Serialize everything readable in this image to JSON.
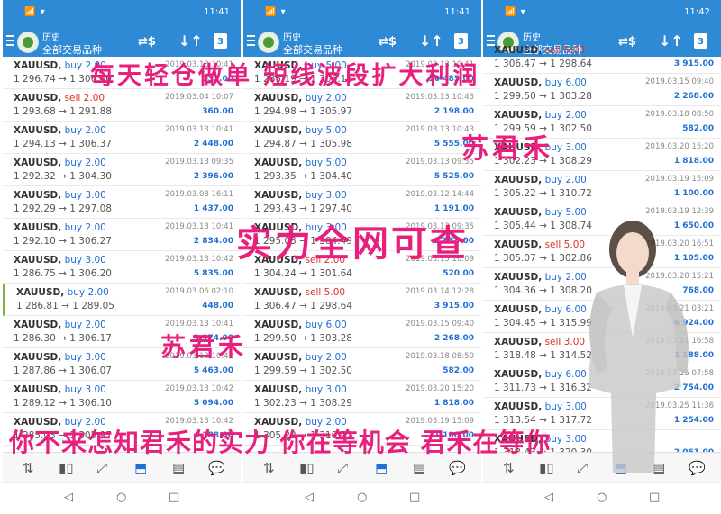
{
  "status_bar": {
    "signal": "📶 ▾",
    "time": [
      "11:41",
      "11:41",
      "11:42"
    ]
  },
  "toolbar": {
    "subtitle": "历史",
    "title": "全部交易品种",
    "calendar_day": "3"
  },
  "panels": [
    {
      "rows": [
        {
          "symbol": "XAUUSD,",
          "side": "buy",
          "vol": "2.00",
          "prices": "1 296.74 → 1 306.40",
          "date": "2019.03.13 10:41",
          "profit": "132.00"
        },
        {
          "symbol": "XAUUSD,",
          "side": "sell",
          "vol": "2.00",
          "prices": "1 293.68 → 1 291.88",
          "date": "2019.03.04 10:07",
          "profit": "360.00"
        },
        {
          "symbol": "XAUUSD,",
          "side": "buy",
          "vol": "2.00",
          "prices": "1 294.13 → 1 306.37",
          "date": "2019.03.13 10:41",
          "profit": "2 448.00"
        },
        {
          "symbol": "XAUUSD,",
          "side": "buy",
          "vol": "2.00",
          "prices": "1 292.32 → 1 304.30",
          "date": "2019.03.13 09:35",
          "profit": "2 396.00"
        },
        {
          "symbol": "XAUUSD,",
          "side": "buy",
          "vol": "3.00",
          "prices": "1 292.29 → 1 297.08",
          "date": "2019.03.08 16:11",
          "profit": "1 437.00"
        },
        {
          "symbol": "XAUUSD,",
          "side": "buy",
          "vol": "2.00",
          "prices": "1 292.10 → 1 306.27",
          "date": "2019.03.13 10:41",
          "profit": "2 834.00"
        },
        {
          "symbol": "XAUUSD,",
          "side": "buy",
          "vol": "3.00",
          "prices": "1 286.75 → 1 306.20",
          "date": "2019.03.13 10:42",
          "profit": "5 835.00"
        },
        {
          "symbol": "XAUUSD,",
          "side": "buy",
          "vol": "2.00",
          "prices": "1 286.81 → 1 289.05",
          "date": "2019.03.06 02:10",
          "profit": "448.00",
          "selected": true
        },
        {
          "symbol": "XAUUSD,",
          "side": "buy",
          "vol": "2.00",
          "prices": "1 286.30 → 1 306.17",
          "date": "2019.03.13 10:41",
          "profit": "3 974.00"
        },
        {
          "symbol": "XAUUSD,",
          "side": "buy",
          "vol": "3.00",
          "prices": "1 287.86 → 1 306.07",
          "date": "2019.03.13 10:42",
          "profit": "5 463.00"
        },
        {
          "symbol": "XAUUSD,",
          "side": "buy",
          "vol": "3.00",
          "prices": "1 289.12 → 1 306.10",
          "date": "2019.03.13 10:42",
          "profit": "5 094.00"
        },
        {
          "symbol": "XAUUSD,",
          "side": "buy",
          "vol": "2.00",
          "prices": "1 285.03 → 1 305.97",
          "date": "2019.03.13 10:42",
          "profit": "4 188.00"
        }
      ]
    },
    {
      "rows": [
        {
          "symbol": "XAUUSD,",
          "side": "buy",
          "vol": "5.00",
          "prices": "1 285.19 → 1 306.16",
          "date": "2019.03.13 10:41",
          "profit": "10 485.00"
        },
        {
          "symbol": "XAUUSD,",
          "side": "buy",
          "vol": "2.00",
          "prices": "1 294.98 → 1 305.97",
          "date": "2019.03.13 10:43",
          "profit": "2 198.00"
        },
        {
          "symbol": "XAUUSD,",
          "side": "buy",
          "vol": "5.00",
          "prices": "1 294.87 → 1 305.98",
          "date": "2019.03.13 10:43",
          "profit": "5 555.00"
        },
        {
          "symbol": "XAUUSD,",
          "side": "buy",
          "vol": "5.00",
          "prices": "1 293.35 → 1 304.40",
          "date": "2019.03.13 09:35",
          "profit": "5 525.00"
        },
        {
          "symbol": "XAUUSD,",
          "side": "buy",
          "vol": "3.00",
          "prices": "1 293.43 → 1 297.40",
          "date": "2019.03.12 14:44",
          "profit": "1 191.00"
        },
        {
          "symbol": "XAUUSD,",
          "side": "buy",
          "vol": "3.00",
          "prices": "1 295.03 → 1 304.49",
          "date": "2019.03.13 09:35",
          "profit": "2 838.00"
        },
        {
          "symbol": "XAUUSD,",
          "side": "sell",
          "vol": "2.00",
          "prices": "1 304.24 → 1 301.64",
          "date": "2019.03.15 16:09",
          "profit": "520.00"
        },
        {
          "symbol": "XAUUSD,",
          "side": "sell",
          "vol": "5.00",
          "prices": "1 306.47 → 1 298.64",
          "date": "2019.03.14 12:28",
          "profit": "3 915.00"
        },
        {
          "symbol": "XAUUSD,",
          "side": "buy",
          "vol": "6.00",
          "prices": "1 299.50 → 1 303.28",
          "date": "2019.03.15 09:40",
          "profit": "2 268.00"
        },
        {
          "symbol": "XAUUSD,",
          "side": "buy",
          "vol": "2.00",
          "prices": "1 299.59 → 1 302.50",
          "date": "2019.03.18 08:50",
          "profit": "582.00"
        },
        {
          "symbol": "XAUUSD,",
          "side": "buy",
          "vol": "3.00",
          "prices": "1 302.23 → 1 308.29",
          "date": "2019.03.20 15:20",
          "profit": "1 818.00"
        },
        {
          "symbol": "XAUUSD,",
          "side": "buy",
          "vol": "2.00",
          "prices": "1 305.22 → 1 310.72",
          "date": "2019.03.19 15:09",
          "profit": "1 100.00"
        }
      ]
    },
    {
      "rows": [
        {
          "symbol": "XAUUSD,",
          "side": "sell",
          "vol": "5.00",
          "prices": "1 306.47 → 1 298.64",
          "date": "",
          "profit": "3 915.00"
        },
        {
          "symbol": "XAUUSD,",
          "side": "buy",
          "vol": "6.00",
          "prices": "1 299.50 → 1 303.28",
          "date": "2019.03.15 09:40",
          "profit": "2 268.00"
        },
        {
          "symbol": "XAUUSD,",
          "side": "buy",
          "vol": "2.00",
          "prices": "1 299.59 → 1 302.50",
          "date": "2019.03.18 08:50",
          "profit": "582.00"
        },
        {
          "symbol": "XAUUSD,",
          "side": "buy",
          "vol": "3.00",
          "prices": "1 302.23 → 1 308.29",
          "date": "2019.03.20 15:20",
          "profit": "1 818.00"
        },
        {
          "symbol": "XAUUSD,",
          "side": "buy",
          "vol": "2.00",
          "prices": "1 305.22 → 1 310.72",
          "date": "2019.03.19 15:09",
          "profit": "1 100.00"
        },
        {
          "symbol": "XAUUSD,",
          "side": "buy",
          "vol": "5.00",
          "prices": "1 305.44 → 1 308.74",
          "date": "2019.03.19 12:39",
          "profit": "1 650.00"
        },
        {
          "symbol": "XAUUSD,",
          "side": "sell",
          "vol": "5.00",
          "prices": "1 305.07 → 1 302.86",
          "date": "2019.03.20 16:51",
          "profit": "1 105.00"
        },
        {
          "symbol": "XAUUSD,",
          "side": "buy",
          "vol": "2.00",
          "prices": "1 304.36 → 1 308.20",
          "date": "2019.03.20 15:21",
          "profit": "768.00"
        },
        {
          "symbol": "XAUUSD,",
          "side": "buy",
          "vol": "6.00",
          "prices": "1 304.45 → 1 315.99",
          "date": "2019.03.21 03:21",
          "profit": "6 924.00"
        },
        {
          "symbol": "XAUUSD,",
          "side": "sell",
          "vol": "3.00",
          "prices": "1 318.48 → 1 314.52",
          "date": "2019.03.21 16:58",
          "profit": "1 188.00"
        },
        {
          "symbol": "XAUUSD,",
          "side": "buy",
          "vol": "6.00",
          "prices": "1 311.73 → 1 316.32",
          "date": "2019.03.25 07:58",
          "profit": "2 754.00"
        },
        {
          "symbol": "XAUUSD,",
          "side": "buy",
          "vol": "3.00",
          "prices": "1 313.54 → 1 317.72",
          "date": "2019.03.25 11:36",
          "profit": "1 254.00"
        },
        {
          "symbol": "XAUUSD,",
          "side": "buy",
          "vol": "3.00",
          "prices": "1 313.43 → 1 320.30",
          "date": "",
          "profit": "2 061.00"
        }
      ]
    }
  ],
  "overlay_text": {
    "line1": "每天轻仓做单 短线波段扩大利润",
    "line2": "苏君禾",
    "line3": "实力全网可查",
    "line4": "苏君禾",
    "line5": "你不来怎知君禾的实力 你在等机会 君禾在等你"
  },
  "bottom_nav": [
    "quotes-icon",
    "chart-icon",
    "trade-icon",
    "history-icon",
    "news-icon",
    "chat-icon"
  ],
  "colors": {
    "header": "#2f8ad6",
    "buy": "#1e6fd6",
    "sell": "#d93025",
    "overlay": "#e8207d"
  }
}
